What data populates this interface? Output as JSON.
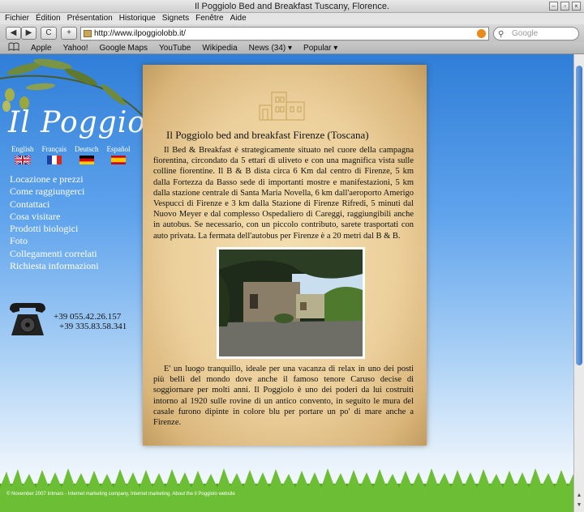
{
  "window": {
    "title": "Il Poggiolo Bed and Breakfast Tuscany, Florence."
  },
  "menubar": [
    "Fichier",
    "Édition",
    "Présentation",
    "Historique",
    "Signets",
    "Fenêtre",
    "Aide"
  ],
  "toolbar": {
    "back_label": "◀",
    "forward_label": "▶",
    "reload_label": "C",
    "add_label": "+",
    "url": "http://www.ilpoggiolobb.it/",
    "search_placeholder": "Google"
  },
  "bookmarks": [
    "Apple",
    "Yahoo!",
    "Google Maps",
    "YouTube",
    "Wikipedia",
    "News (34) ▾",
    "Popular ▾"
  ],
  "site": {
    "logo": "Il Poggiolo",
    "languages": [
      {
        "label": "English"
      },
      {
        "label": "Français"
      },
      {
        "label": "Deutsch"
      },
      {
        "label": "Español"
      }
    ],
    "nav": [
      "Locazione e prezzi",
      "Come raggiungerci",
      "Contattaci",
      "Cosa visitare",
      "Prodotti biologici",
      "Foto",
      "Collegamenti correlati",
      "Richiesta informazioni"
    ],
    "phone1": "+39 055.42.26.157",
    "phone2": "+39 335.83.58.341",
    "heading": "Il Poggiolo bed and breakfast Firenze (Toscana)",
    "para1": "Il Bed & Breakfast é strategicamente situato nel cuore della campagna fiorentina, circondato da 5 ettari di uliveto e con una magnifica vista sulle colline fiorentine. Il B & B dista circa 6 Km dal centro di Firenze, 5 km dalla Fortezza da Basso sede di importanti mostre e manifestazioni, 5 km dalla stazione centrale di Santa Maria Novella, 6 km dall'aeroporto Amerigo Vespucci di Firenze e 3 km dalla Stazione di Firenze Rifredi, 5 minuti dal Nuovo Meyer e dal complesso Ospedaliero di Careggi, raggiungibili anche in autobus. Se necessario, con un piccolo contributo, sarete trasportati con auto privata. La fermata dell'autobus per Firenze è a 20 metri dal B & B.",
    "para2": "E' un luogo tranquillo, ideale per una vacanza di relax in uno dei posti più belli del mondo dove anche il famoso tenore Caruso decise di soggiornare per molti anni. Il Poggiolo è uno dei poderi da lui costruiti intorno al 1920 sulle rovine di un antico convento, in seguito le mura del casale furono dipinte in colore blu per portare un po' di mare anche a Firenze.",
    "footer": "© November 2007 Intmarc - Internet marketing company, Internet marketing. About the Il Poggiolo website"
  },
  "colors": {
    "sky_top": "#2f7ed8",
    "parchment": "#ecd09c",
    "nav_text": "#ffffff"
  },
  "icons": [
    "back-icon",
    "forward-icon",
    "reload-icon",
    "add-icon",
    "search-icon",
    "rss-icon",
    "bookmarks-book-icon",
    "telephone-icon"
  ]
}
